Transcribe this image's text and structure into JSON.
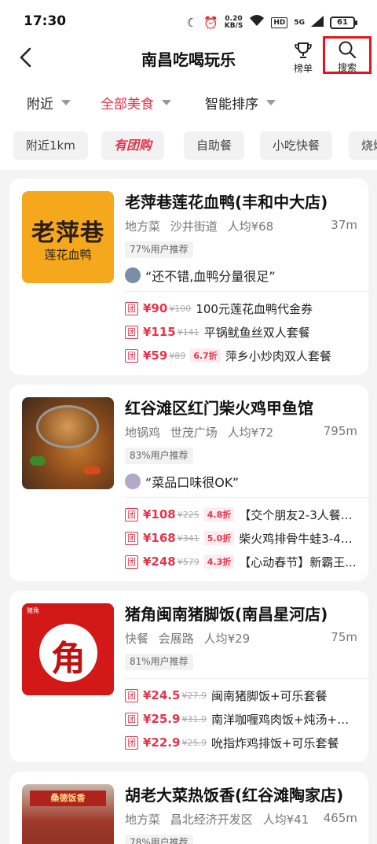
{
  "status": {
    "time": "17:30",
    "netspeed_value": "0.20",
    "netspeed_unit": "KB/S",
    "hd": "HD",
    "signal": "5G",
    "battery": "61"
  },
  "header": {
    "title": "南昌吃喝玩乐",
    "rank_label": "榜单",
    "search_label": "搜索"
  },
  "filters": {
    "nearby": "附近",
    "all_food": "全部美食",
    "sort": "智能排序"
  },
  "chips": [
    "附近1km",
    "有团购",
    "自助餐",
    "小吃快餐",
    "烧烤"
  ],
  "colors": {
    "accent": "#e8334a",
    "highlight": "#e8121c"
  },
  "cards": [
    {
      "logo_text_1": "老萍巷",
      "logo_text_2": "莲花血鸭",
      "name": "老萍巷莲花血鸭(丰和中大店)",
      "cuisine": "地方菜",
      "area": "沙井街道",
      "avg": "人均¥68",
      "distance": "37m",
      "recommend": "77%用户推荐",
      "review": "“还不错,血鸭分量很足”",
      "deals": [
        {
          "price": "¥90",
          "orig": "¥100",
          "discount": "",
          "title": "100元莲花血鸭代金券"
        },
        {
          "price": "¥115",
          "orig": "¥141",
          "discount": "",
          "title": "平锅鱿鱼丝双人套餐"
        },
        {
          "price": "¥59",
          "orig": "¥89",
          "discount": "6.7折",
          "title": "萍乡小炒肉双人套餐"
        }
      ]
    },
    {
      "name": "红谷滩区红门柴火鸡甲鱼馆",
      "cuisine": "地锅鸡",
      "area": "世茂广场",
      "avg": "人均¥72",
      "distance": "795m",
      "recommend": "83%用户推荐",
      "review": "“菜品口味很OK”",
      "deals": [
        {
          "price": "¥108",
          "orig": "¥225",
          "discount": "4.8折",
          "title": "【交个朋友2-3人餐】..."
        },
        {
          "price": "¥168",
          "orig": "¥341",
          "discount": "5.0折",
          "title": "柴火鸡排骨牛蛙3-4人..."
        },
        {
          "price": "¥248",
          "orig": "¥579",
          "discount": "4.3折",
          "title": "【心动春节】新霸王..."
        }
      ]
    },
    {
      "logo_text": "角",
      "logo_small": "猪角",
      "name": "猪角闽南猪脚饭(南昌星河店)",
      "cuisine": "快餐",
      "area": "会展路",
      "avg": "人均¥29",
      "distance": "75m",
      "recommend": "81%用户推荐",
      "deals": [
        {
          "price": "¥24.5",
          "orig": "¥27.9",
          "discount": "",
          "title": "闽南猪脚饭+可乐套餐"
        },
        {
          "price": "¥25.9",
          "orig": "¥31.9",
          "discount": "",
          "title": "南洋咖喱鸡肉饭+炖汤+可..."
        },
        {
          "price": "¥22.9",
          "orig": "¥25.9",
          "discount": "",
          "title": "吮指炸鸡排饭+可乐套餐"
        }
      ]
    },
    {
      "logo_text": "桑德饭香",
      "name": "胡老大菜热饭香(红谷滩陶家店)",
      "cuisine": "地方菜",
      "area": "昌北经济开发区",
      "avg": "人均¥41",
      "distance": "465m",
      "recommend": "78%用户推荐"
    }
  ],
  "deal_tag": "团"
}
